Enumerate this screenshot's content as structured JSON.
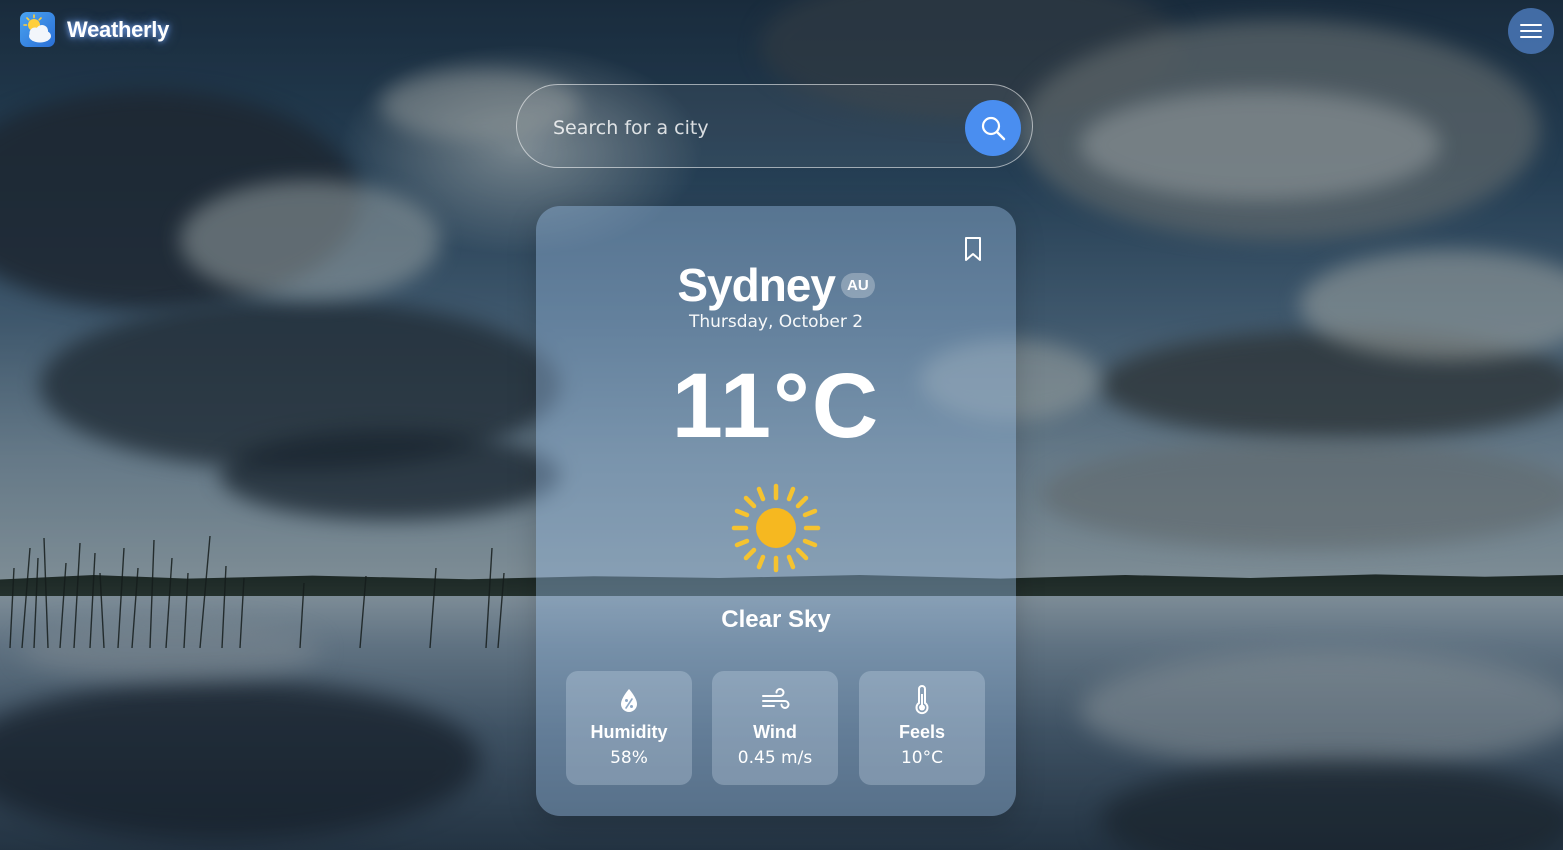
{
  "app": {
    "name": "Weatherly"
  },
  "icons": {
    "logo": "weather-logo-icon",
    "menu": "hamburger-menu-icon",
    "search": "search-icon",
    "bookmark": "bookmark-icon",
    "condition": "sun-icon",
    "humidity": "humidity-drop-icon",
    "wind": "wind-icon",
    "feels": "thermometer-icon"
  },
  "colors": {
    "accent": "#4a8ef0",
    "menu_button": "#5082c8",
    "sun": "#f6b820",
    "sun_rays": "#f5c330"
  },
  "search": {
    "placeholder": "Search for a city",
    "value": ""
  },
  "weather": {
    "city": "Sydney",
    "country": "AU",
    "date": "Thursday, October 2",
    "temperature": "11°C",
    "condition": "Clear Sky",
    "stats": [
      {
        "label": "Humidity",
        "value": "58%"
      },
      {
        "label": "Wind",
        "value": "0.45 m/s"
      },
      {
        "label": "Feels",
        "value": "10°C"
      }
    ]
  }
}
